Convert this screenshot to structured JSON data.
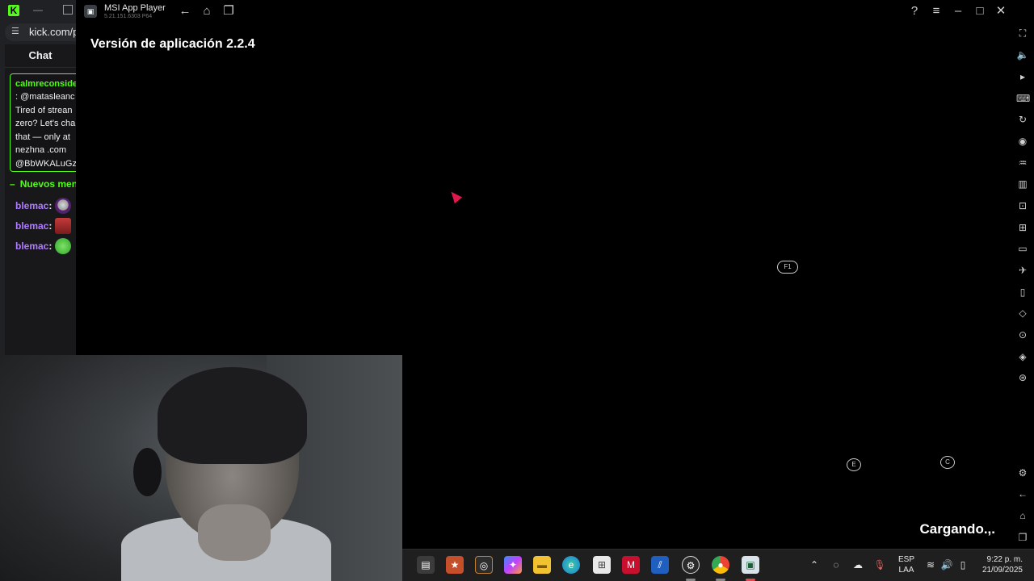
{
  "browser": {
    "tab_logo": "K",
    "url": "kick.com/p"
  },
  "chat": {
    "title": "Chat",
    "pinned": {
      "user": "calmreconside",
      "lines": [
        ": @matasleanc",
        "Tired of strean",
        "zero? Let's cha",
        "that — only at",
        "nezhna .com",
        "@BbWKALuGz"
      ]
    },
    "new_messages_label": "Nuevos men",
    "messages": [
      {
        "user": "blemac",
        "colon": ":"
      },
      {
        "user": "blemac",
        "colon": ":"
      },
      {
        "user": "blemac",
        "colon": ":"
      }
    ]
  },
  "app": {
    "name": "MSI App Player",
    "version": "5.21.151.6303 P64"
  },
  "screen": {
    "version_text": "Versión de aplicación 2.2.4",
    "key_hints": [
      "F1",
      "E",
      "C"
    ],
    "loading_text": "Cargando.,."
  },
  "taskbar": {
    "lang_top": "ESP",
    "lang_bottom": "LAA",
    "time": "9:22 p. m.",
    "date": "21/09/2025"
  },
  "colors": {
    "kick_green": "#53fc18",
    "username_purple": "#b07cff",
    "cursor_red": "#e0184c"
  }
}
